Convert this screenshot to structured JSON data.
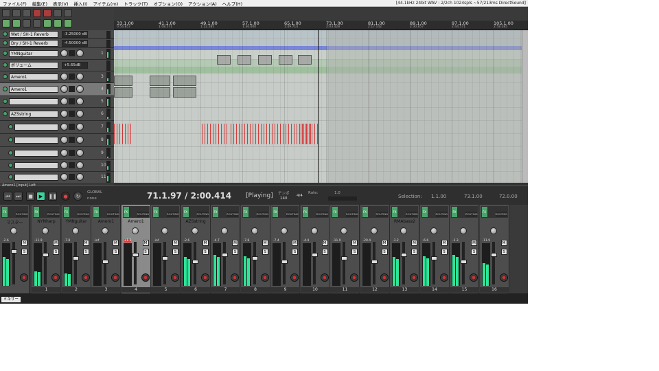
{
  "menu": [
    "ファイル(F)",
    "編集(E)",
    "表示(V)",
    "挿入(I)",
    "アイテム(m)",
    "トラック(T)",
    "オプション(O)",
    "アクション(A)",
    "ヘルプ(H)"
  ],
  "status": "[44.1kHz 24bit WAV : 2/2ch 1024spls ~57/213ms DirectSound]",
  "tracks": [
    {
      "name": "Wet / SH-1 Reverb",
      "vol": "-3.25000 dB",
      "num": ""
    },
    {
      "name": "Dry / SH-1 Reverb",
      "vol": "-4.50000 dB",
      "num": ""
    },
    {
      "name": "YMNguitar",
      "vol": "",
      "num": "1"
    },
    {
      "name": "ボリューム",
      "vol": "+5.65dB",
      "num": ""
    },
    {
      "name": "Amero1",
      "vol": "",
      "num": "3"
    },
    {
      "name": "Amero1",
      "vol": "",
      "num": "4"
    },
    {
      "name": "",
      "vol": "",
      "num": "5"
    },
    {
      "name": "AZSstring",
      "vol": "",
      "num": "6"
    },
    {
      "name": "",
      "vol": "",
      "num": "7"
    },
    {
      "name": "",
      "vol": "",
      "num": "8"
    },
    {
      "name": "",
      "vol": "",
      "num": "9"
    },
    {
      "name": "",
      "vol": "",
      "num": "10"
    },
    {
      "name": "",
      "vol": "",
      "num": "11"
    }
  ],
  "ruler": [
    {
      "bar": "33.1.00",
      "time": "0:54.857"
    },
    {
      "bar": "41.1.00",
      "time": "1:08.571"
    },
    {
      "bar": "49.1.00",
      "time": "1:22.285"
    },
    {
      "bar": "57.1.00",
      "time": "1:36.000"
    },
    {
      "bar": "65.1.00",
      "time": "1:49.714"
    },
    {
      "bar": "73.1.00",
      "time": "2:03.428"
    },
    {
      "bar": "81.1.00",
      "time": "2:17.142"
    },
    {
      "bar": "89.1.00",
      "time": "2:30.857"
    },
    {
      "bar": "97.1.00",
      "time": "2:44.571"
    },
    {
      "bar": "105.1.00",
      "time": "2:58.285"
    }
  ],
  "transport": {
    "track_label": "Amero1 [input] Left",
    "time": "71.1.97 / 2:00.414",
    "state": "[Playing]",
    "tempo_label": "テンポ",
    "tempo": "140",
    "timesig": "4/4",
    "rate_label": "Rate:",
    "rate": "1.0",
    "selection_label": "Selection:",
    "sel_start": "1.1.00",
    "sel_end": "73.1.00",
    "sel_len": "72.0.00",
    "global_label": "GLOBAL",
    "global_mode": "none"
  },
  "mixer": {
    "master_name": "マスター",
    "fx_label": "FX",
    "routing_label": "ROUTING",
    "m_label": "M",
    "s_label": "S",
    "tab_label": "ミキサー",
    "strips": [
      {
        "name": "NYNharp",
        "num": "1",
        "db": "-11.9",
        "fill": 0.35
      },
      {
        "name": "YMNguitar",
        "num": "2",
        "db": "-7.8",
        "fill": 0.3
      },
      {
        "name": "Amero1",
        "num": "3",
        "db": "-inf",
        "fill": 0.0
      },
      {
        "name": "Amero1",
        "num": "4",
        "db": "+1.5",
        "fill": 0.0
      },
      {
        "name": "",
        "num": "5",
        "db": "-inf",
        "fill": 0.0
      },
      {
        "name": "AZSstring",
        "num": "6",
        "db": "-2.6",
        "fill": 0.7
      },
      {
        "name": "",
        "num": "7",
        "db": "-4.7",
        "fill": 0.75
      },
      {
        "name": "",
        "num": "8",
        "db": "-7.8",
        "fill": 0.72
      },
      {
        "name": "",
        "num": "9",
        "db": "-7.4",
        "fill": 0.0
      },
      {
        "name": "",
        "num": "10",
        "db": "-4.4",
        "fill": 0.0
      },
      {
        "name": "",
        "num": "11",
        "db": "-11.9",
        "fill": 0.0
      },
      {
        "name": "",
        "num": "12",
        "db": "-20.4",
        "fill": 0.0
      },
      {
        "name": "RMAbass2",
        "num": "13",
        "db": "-3.2",
        "fill": 0.7
      },
      {
        "name": "",
        "num": "14",
        "db": "-6.6",
        "fill": 0.72
      },
      {
        "name": "",
        "num": "15",
        "db": "-1.3",
        "fill": 0.75
      },
      {
        "name": "",
        "num": "16",
        "db": "-11.9",
        "fill": 0.55
      }
    ],
    "master_db": "-2.6"
  },
  "colors": {
    "meter": "#2ee597",
    "play": "#3fd19a",
    "selected_db": "#e43a3a"
  }
}
